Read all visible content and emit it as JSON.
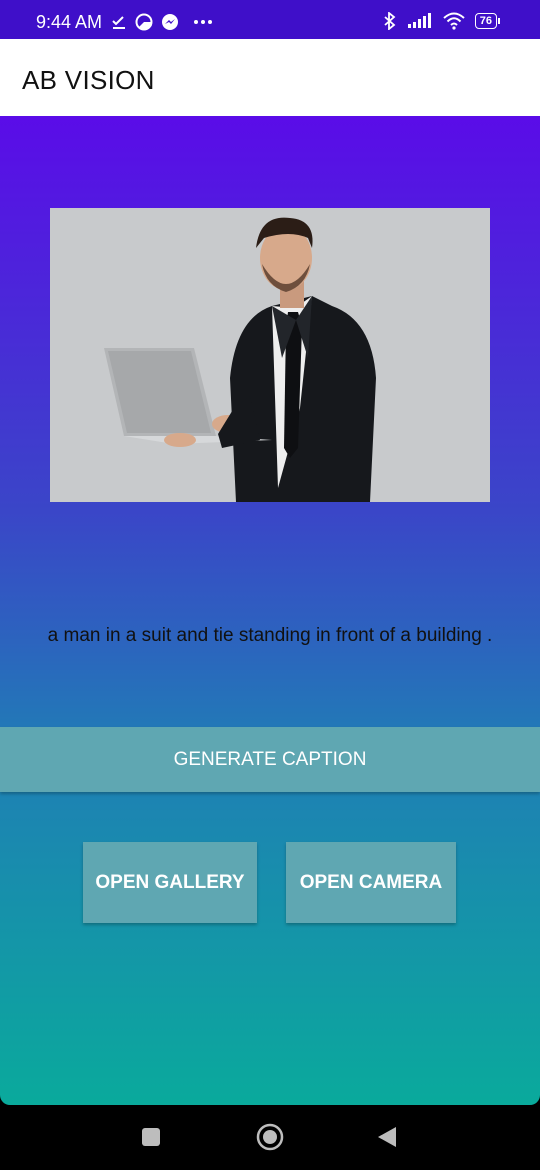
{
  "status_bar": {
    "time": "9:44 AM",
    "battery": "76",
    "icons_left": [
      "download-done-icon",
      "data-saver-icon",
      "messenger-icon",
      "more-dots-icon"
    ],
    "icons_right": [
      "bluetooth-icon",
      "signal-icon",
      "wifi-icon",
      "battery-icon"
    ]
  },
  "app_bar": {
    "title": "AB VISION"
  },
  "main": {
    "image": {
      "subject": "man-in-suit-holding-laptop"
    },
    "caption": "a man in a suit and tie standing in front of a building .",
    "generate_button": "GENERATE CAPTION",
    "gallery_button": "OPEN GALLERY",
    "camera_button": "OPEN CAMERA"
  },
  "nav_bar": {
    "buttons": [
      "recents-button",
      "home-button",
      "back-button"
    ]
  },
  "colors": {
    "status_bar": "#3f0fc9",
    "gradient_top": "#5a0ce8",
    "gradient_bottom": "#0aaa9c",
    "button": "#5fa7b2"
  }
}
